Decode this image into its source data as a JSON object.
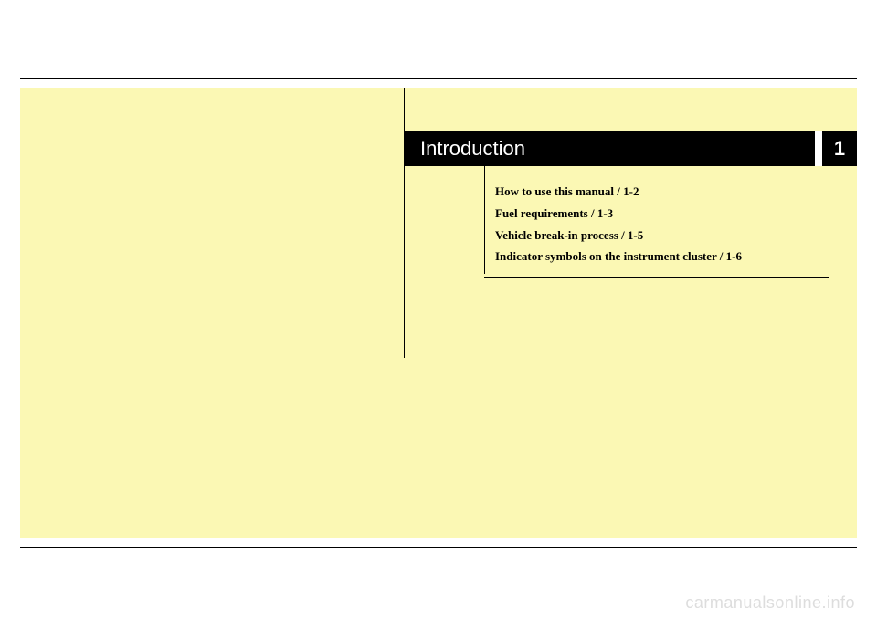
{
  "chapter": {
    "title": "Introduction",
    "number": "1"
  },
  "toc": {
    "items": [
      "How to use this manual / 1-2",
      "Fuel requirements / 1-3",
      "Vehicle break-in process / 1-5",
      "Indicator symbols on the instrument cluster / 1-6"
    ]
  },
  "watermark": "carmanualsonline.info"
}
